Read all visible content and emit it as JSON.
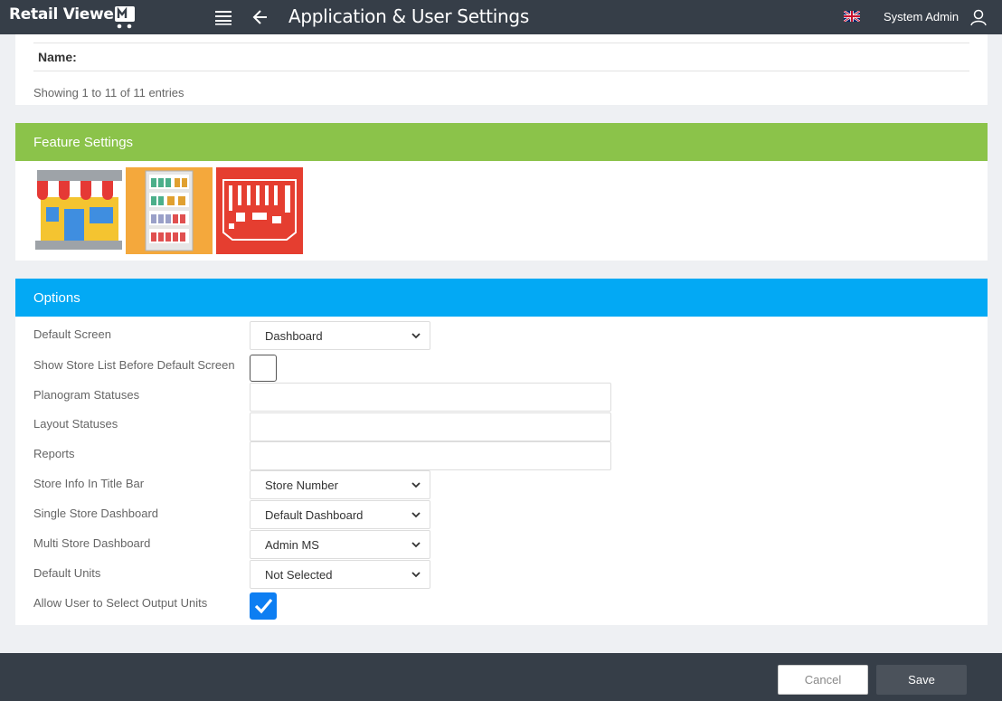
{
  "app": {
    "logo_text": "Retail Viewer",
    "page_title": "Application & User Settings",
    "user_name": "System Admin",
    "icons": {
      "menu": "menu-icon",
      "back": "back-arrow-icon",
      "flag": "uk-flag-icon",
      "user": "user-icon",
      "cart": "cart-logo-icon"
    }
  },
  "list": {
    "name_label": "Name:",
    "showing_text": "Showing 1 to 11 of 11 entries"
  },
  "feature_settings": {
    "title": "Feature Settings",
    "header_color": "#8bc34a",
    "tiles": [
      {
        "icon": "store-icon"
      },
      {
        "icon": "shelf-planogram-icon"
      },
      {
        "icon": "floor-layout-icon"
      }
    ]
  },
  "options": {
    "title": "Options",
    "header_color": "#03a9f4",
    "fields": {
      "default_screen": {
        "label": "Default Screen",
        "value": "Dashboard"
      },
      "show_store_list": {
        "label": "Show Store List Before Default Screen",
        "checked": false
      },
      "planogram_statuses": {
        "label": "Planogram Statuses",
        "value": ""
      },
      "layout_statuses": {
        "label": "Layout Statuses",
        "value": ""
      },
      "reports": {
        "label": "Reports",
        "value": ""
      },
      "store_info_title_bar": {
        "label": "Store Info In Title Bar",
        "value": "Store Number"
      },
      "single_store_dashboard": {
        "label": "Single Store Dashboard",
        "value": "Default Dashboard"
      },
      "multi_store_dashboard": {
        "label": "Multi Store Dashboard",
        "value": "Admin MS"
      },
      "default_units": {
        "label": "Default Units",
        "value": "Not Selected"
      },
      "allow_output_units": {
        "label": "Allow User to Select Output Units",
        "checked": true
      }
    }
  },
  "footer": {
    "cancel_label": "Cancel",
    "save_label": "Save"
  }
}
